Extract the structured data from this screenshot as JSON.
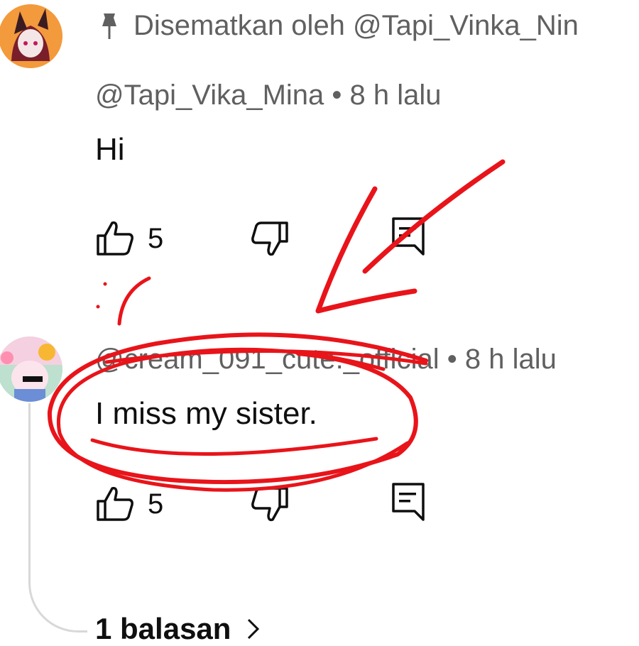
{
  "colors": {
    "text": "#0f0f0f",
    "meta": "#606060",
    "annotation": "#e8141a",
    "thread": "#d8d8d8"
  },
  "pinned_comment": {
    "pin_label": "Disematkan oleh @Tapi_Vinka_Nin",
    "author": "@Tapi_Vika_Mina",
    "time": "8 h lalu",
    "separator": "•",
    "text": "Hi",
    "likes": "5",
    "icons": [
      "pin-icon",
      "like-icon",
      "dislike-icon",
      "reply-icon"
    ]
  },
  "second_comment": {
    "author": "@cream_091_cute._official",
    "time": "8 h lalu",
    "separator": "•",
    "text": "I miss my sister.",
    "likes": "5",
    "icons": [
      "like-icon",
      "dislike-icon",
      "reply-icon"
    ]
  },
  "replies": {
    "label": "1 balasan",
    "icon": "chevron-right-icon"
  }
}
